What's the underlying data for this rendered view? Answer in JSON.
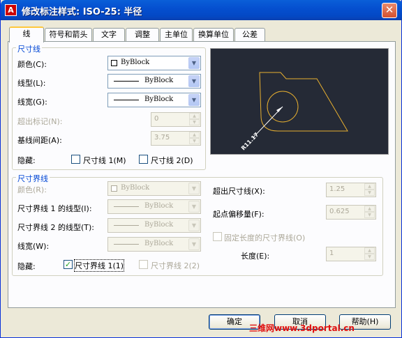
{
  "window": {
    "title": "修改标注样式: ISO-25: 半径",
    "app_icon_letter": "A",
    "close_glyph": "✕"
  },
  "tabs": [
    "线",
    "符号和箭头",
    "文字",
    "调整",
    "主单位",
    "换算单位",
    "公差"
  ],
  "dim_line": {
    "group_label": "尺寸线",
    "color_label": "颜色(C):",
    "color_value": "ByBlock",
    "linetype_label": "线型(L):",
    "linetype_value": "ByBlock",
    "lineweight_label": "线宽(G):",
    "lineweight_value": "ByBlock",
    "extend_label": "超出标记(N):",
    "extend_value": "0",
    "baseline_label": "基线间距(A):",
    "baseline_value": "3.75",
    "suppress_label": "隐藏:",
    "suppress1_label": "尺寸线 1(M)",
    "suppress1_checked": false,
    "suppress2_label": "尺寸线 2(D)",
    "suppress2_checked": false
  },
  "ext_line": {
    "group_label": "尺寸界线",
    "color_label": "颜色(R):",
    "color_value": "ByBlock",
    "lt1_label": "尺寸界线 1 的线型(I):",
    "lt1_value": "ByBlock",
    "lt2_label": "尺寸界线 2 的线型(T):",
    "lt2_value": "ByBlock",
    "lineweight_label": "线宽(W):",
    "lineweight_value": "ByBlock",
    "suppress_label": "隐藏:",
    "suppress1_label": "尺寸界线 1(1)",
    "suppress1_checked": true,
    "suppress2_label": "尺寸界线 2(2)",
    "suppress2_checked": false,
    "beyond_label": "超出尺寸线(X):",
    "beyond_value": "1.25",
    "offset_label": "起点偏移量(F):",
    "offset_value": "0.625",
    "fixed_label": "固定长度的尺寸界线(O)",
    "fixed_checked": false,
    "length_label": "长度(E):",
    "length_value": "1"
  },
  "preview": {
    "dim_text": "R11.17"
  },
  "buttons": {
    "ok": "确定",
    "cancel": "取消",
    "help": "帮助(H)"
  },
  "watermark": "三维网www.3dportal.cn",
  "colors": {
    "accent_tab": "#ffc83c",
    "group_label": "#0046d5",
    "preview_bg": "#252a36",
    "preview_geom": "#e8b030"
  }
}
